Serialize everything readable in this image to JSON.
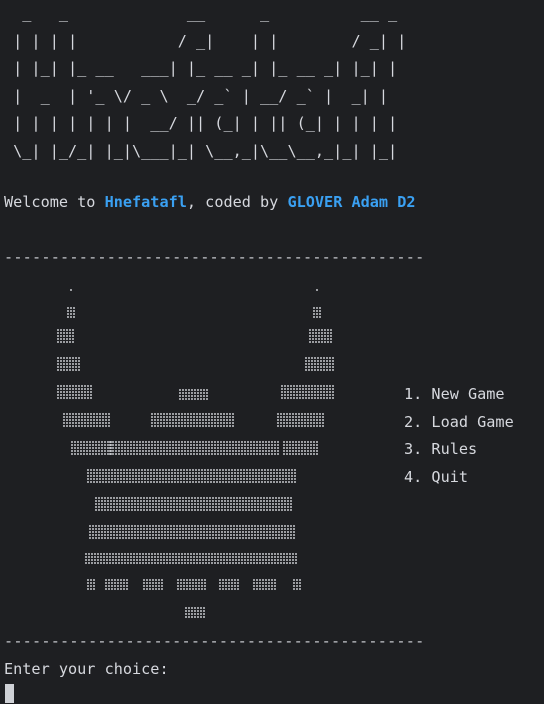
{
  "banner_art": "  _   _             __      _          __ _\n | | | |           / _|    | |        / _| |\n | |_| |_ __   ___| |_ __ _| |_ __ _| |_| |\n |  _  | '_ \\/ _ \\  _/ _` | __/ _` |  _| |\n | | | | | | |  __/ || (_| | || (_| | | | |\n \\_| |_/_| |_|\\___|_| \\__,_|\\__\\__,_|_| |_|",
  "welcome": {
    "prefix": "Welcome to ",
    "game_name": "Hnefatafl",
    "middle": ", coded by ",
    "author": "GLOVER Adam D2"
  },
  "separator": "---------------------------------------------",
  "menu": {
    "items": [
      {
        "label": "1. New Game"
      },
      {
        "label": "2. Load Game"
      },
      {
        "label": "3. Rules"
      },
      {
        "label": "4. Quit"
      }
    ]
  },
  "prompt": "Enter your choice:",
  "colors": {
    "background": "#1e1f22",
    "text": "#d6d8de",
    "highlight": "#3aa0f2"
  },
  "icons": {
    "art": "viking-helmet-braille-art-icon",
    "cursor": "block-cursor-icon"
  }
}
